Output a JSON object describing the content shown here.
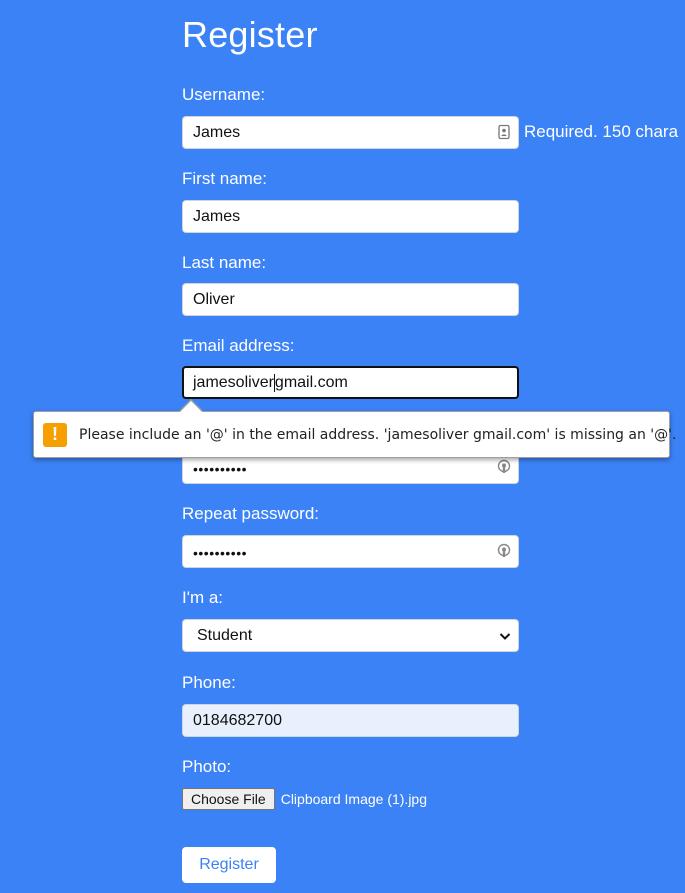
{
  "page": {
    "title": "Register"
  },
  "form": {
    "username": {
      "label": "Username:",
      "value": "James",
      "help": "Required. 150 chara"
    },
    "first_name": {
      "label": "First name:",
      "value": "James"
    },
    "last_name": {
      "label": "Last name:",
      "value": "Oliver"
    },
    "email": {
      "label": "Email address:",
      "value_before_caret": "jamesoliver",
      "value_after_caret": "gmail.com"
    },
    "password": {
      "value": "••••••••••"
    },
    "repeat_password": {
      "label": "Repeat password:",
      "value": "••••••••••"
    },
    "role": {
      "label": "I'm a:",
      "selected": "Student"
    },
    "phone": {
      "label": "Phone:",
      "value": "0184682700"
    },
    "photo": {
      "label": "Photo:",
      "button_label": "Choose File",
      "file_name": "Clipboard Image (1).jpg"
    },
    "submit_label": "Register"
  },
  "validation_tooltip": {
    "icon": "!",
    "message": "Please include an '@' in the email address. 'jamesoliver gmail.com' is missing an '@'."
  },
  "icons": {
    "username_field": "contact-card-icon",
    "password_field": "key-icon",
    "select": "chevron-down-icon",
    "tooltip": "warning-icon"
  },
  "colors": {
    "background": "#3b82f6",
    "warning": "#f59f00",
    "autofill": "#e8f0fe"
  }
}
